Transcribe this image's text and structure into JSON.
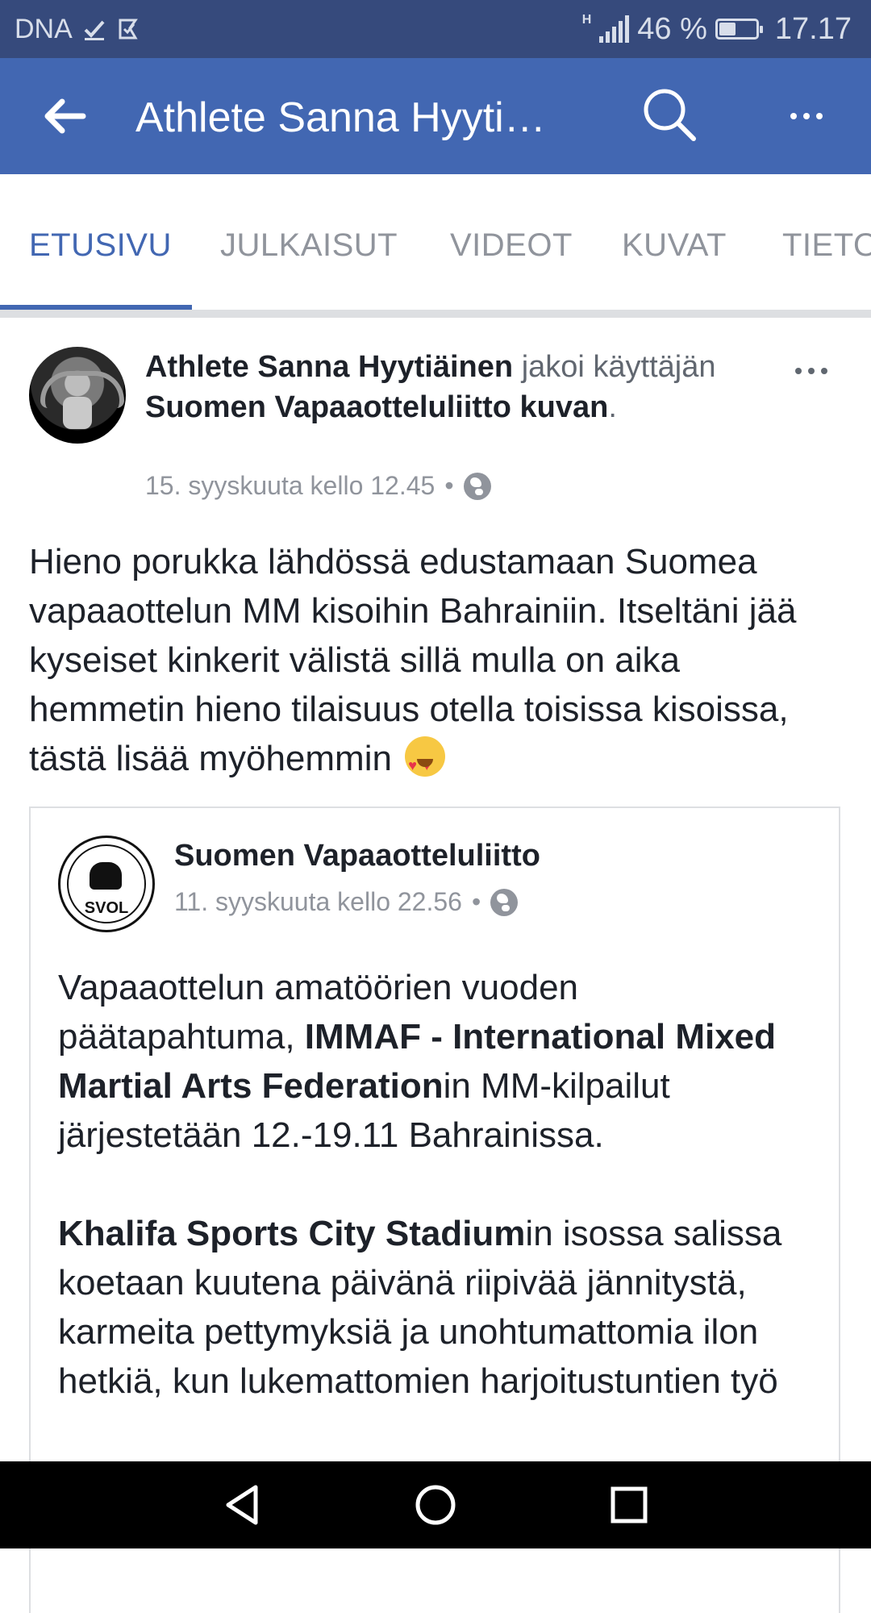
{
  "status_bar": {
    "carrier": "DNA",
    "battery_percent": "46 %",
    "battery_level": 0.46,
    "network": "H",
    "time": "17.17"
  },
  "app_bar": {
    "title": "Athlete Sanna Hyyti…",
    "back_icon": "arrow-left-icon",
    "search_icon": "search-icon",
    "more_icon": "more-dots-icon"
  },
  "tabs": [
    {
      "label": "ETUSIVU",
      "active": true
    },
    {
      "label": "JULKAISUT",
      "active": false
    },
    {
      "label": "VIDEOT",
      "active": false
    },
    {
      "label": "KUVAT",
      "active": false
    },
    {
      "label": "TIETO",
      "active": false
    }
  ],
  "post": {
    "author": "Athlete Sanna Hyytiäinen",
    "action_1": "jakoi",
    "action_2": "käyttäjän",
    "shared_from": "Suomen Vapaaotteluliitto",
    "object": "kuvan",
    "period": ".",
    "timestamp": "15. syyskuuta kello 12.45",
    "separator": "•",
    "privacy_icon": "globe-icon",
    "text": "Hieno porukka lähdössä edustamaan Suomea vapaaottelun MM kisoihin Bahrainiin. Itseltäni jää kyseiset kinkerit välistä sillä mulla on aika hemmetin hieno tilaisuus otella toisissa kisoissa, tästä lisää myöhemmin",
    "emoji_icon": "heart-eyes-emoji-icon"
  },
  "shared_post": {
    "page_name": "Suomen Vapaaotteluliitto",
    "logo_text": "SVOL",
    "timestamp": "11. syyskuuta kello 22.56",
    "separator": "•",
    "privacy_icon": "globe-icon",
    "p1_a": "Vapaaottelun amatöörien vuoden päätapahtuma, ",
    "p1_bold": "IMMAF - International Mixed Martial Arts Federation",
    "p1_b": "in MM-kilpailut järjestetään 12.-19.11 Bahrainissa.",
    "p2_bold": "Khalifa Sports City Stadium",
    "p2_a": "in isossa salissa koetaan kuutena päivänä riipivää jännitystä, karmeita pettymyksiä ja unohtumattomia ilon hetkiä, kun lukemattomien harjoitustuntien työ"
  },
  "nav_bar": {
    "back_icon": "nav-back-triangle-icon",
    "home_icon": "nav-home-circle-icon",
    "recents_icon": "nav-recents-square-icon"
  },
  "colors": {
    "status_bar": "#364a7c",
    "app_bar": "#4267b2",
    "accent": "#4267b2",
    "muted_text": "#90949c"
  }
}
